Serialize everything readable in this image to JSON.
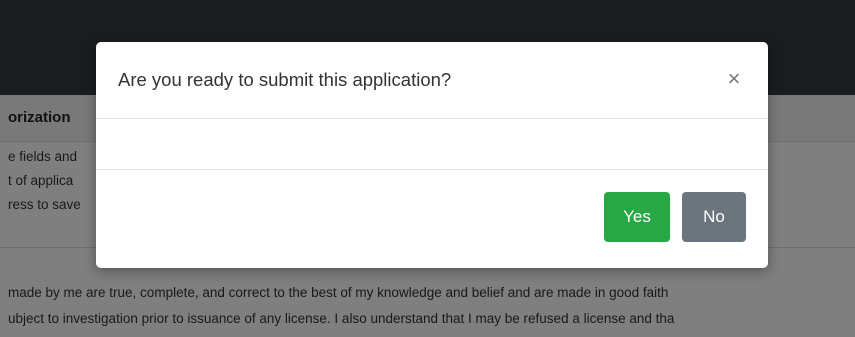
{
  "background": {
    "section_title": "orization",
    "instructions": [
      "e fields and",
      "t of applica",
      "ress to save"
    ],
    "certification": [
      "made by me are true, complete, and correct to the best of my knowledge and belief and are made in good faith",
      "ubject to investigation prior to issuance of any license. I also understand that I may be refused a license and tha"
    ]
  },
  "modal": {
    "title": "Are you ready to submit this application?",
    "close_symbol": "×",
    "buttons": {
      "yes_label": "Yes",
      "no_label": "No"
    }
  },
  "colors": {
    "yes": "#28a745",
    "no": "#6c757d",
    "topbar": "#343a40"
  }
}
